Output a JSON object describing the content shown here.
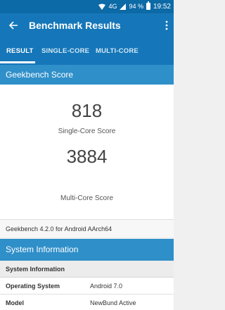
{
  "status_bar": {
    "network": "4G",
    "battery_percent": "94 %",
    "battery_level": 0.94,
    "time": "19:52"
  },
  "app_bar": {
    "title": "Benchmark Results"
  },
  "tabs": [
    {
      "label": "RESULT",
      "active": true
    },
    {
      "label": "SINGLE-CORE",
      "active": false
    },
    {
      "label": "MULTI-CORE",
      "active": false
    }
  ],
  "geekbench": {
    "header": "Geekbench Score",
    "single_core_score": "818",
    "single_core_label": "Single-Core Score",
    "multi_core_score": "3884",
    "multi_core_label": "Multi-Core Score",
    "version": "Geekbench 4.2.0 for Android AArch64"
  },
  "system_info": {
    "header": "System Information",
    "group_label": "System Information",
    "rows": [
      {
        "key": "Operating System",
        "value": "Android 7.0"
      },
      {
        "key": "Model",
        "value": "NewBund Active"
      }
    ]
  },
  "colors": {
    "primary": "#1577b9",
    "status_bar": "#0c6aa6",
    "section_header": "#2f8fc9"
  }
}
